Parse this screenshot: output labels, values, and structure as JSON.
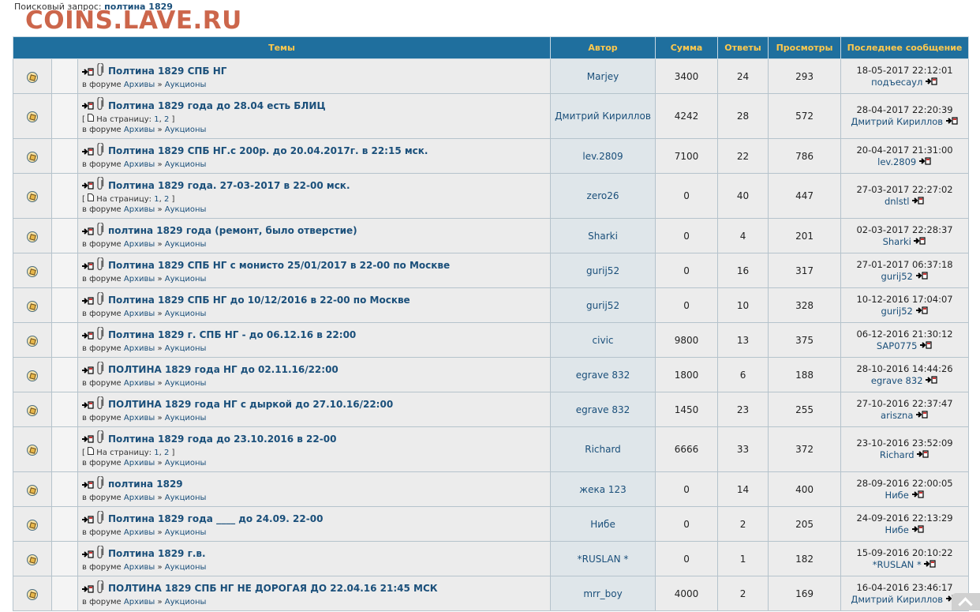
{
  "search": {
    "label": "Поисковый запрос:",
    "query": "полтина 1829"
  },
  "watermark": "COINS.LAVE.RU",
  "headers": {
    "topics": "Темы",
    "author": "Автор",
    "sum": "Сумма",
    "replies": "Ответы",
    "views": "Просмотры",
    "last": "Последнее сообщение"
  },
  "labels": {
    "in_forum": "в форуме",
    "forum_archive": "Архивы",
    "sep": "»",
    "forum_auctions": "Аукционы",
    "pages_open": "[",
    "pages_label": "На страницу:",
    "page1": "1",
    "page2": "2",
    "pages_close": "]"
  },
  "colors": {
    "header_bg": "#1f6f9e",
    "header_text": "#ffc94d",
    "link": "#1a4f7a",
    "watermark": "#c85a3c"
  },
  "rows": [
    {
      "title": "Полтина 1829 СПБ НГ",
      "pages": false,
      "author": "Marjey",
      "sum": "3400",
      "replies": "24",
      "views": "293",
      "last_date": "18-05-2017 22:12:01",
      "last_user": "подъесаул"
    },
    {
      "title": "Полтина 1829 года до 28.04 есть БЛИЦ",
      "pages": true,
      "author": "Дмитрий Кириллов",
      "sum": "4242",
      "replies": "28",
      "views": "572",
      "last_date": "28-04-2017 22:20:39",
      "last_user": "Дмитрий Кириллов"
    },
    {
      "title": "Полтина 1829 СПБ НГ.с 200р. до 20.04.2017г. в 22:15 мск.",
      "pages": false,
      "author": "lev.2809",
      "sum": "7100",
      "replies": "22",
      "views": "786",
      "last_date": "20-04-2017 21:31:00",
      "last_user": "lev.2809"
    },
    {
      "title": "Полтина 1829 года. 27-03-2017 в 22-00 мск.",
      "pages": true,
      "author": "zero26",
      "sum": "0",
      "replies": "40",
      "views": "447",
      "last_date": "27-03-2017 22:27:02",
      "last_user": "dnlstl"
    },
    {
      "title": "полтина 1829 года (ремонт, было отверстие)",
      "pages": false,
      "author": "Sharki",
      "sum": "0",
      "replies": "4",
      "views": "201",
      "last_date": "02-03-2017 22:28:37",
      "last_user": "Sharki"
    },
    {
      "title": "Полтина 1829 СПБ НГ с монисто 25/01/2017 в 22-00 по Москве",
      "pages": false,
      "author": "gurij52",
      "sum": "0",
      "replies": "16",
      "views": "317",
      "last_date": "27-01-2017 06:37:18",
      "last_user": "gurij52"
    },
    {
      "title": "Полтина 1829 СПБ НГ до 10/12/2016 в 22-00 по Москве",
      "pages": false,
      "author": "gurij52",
      "sum": "0",
      "replies": "10",
      "views": "328",
      "last_date": "10-12-2016 17:04:07",
      "last_user": "gurij52"
    },
    {
      "title": "Полтина 1829 г. СПБ НГ - до 06.12.16 в 22:00",
      "pages": false,
      "author": "civic",
      "sum": "9800",
      "replies": "13",
      "views": "375",
      "last_date": "06-12-2016 21:30:12",
      "last_user": "SAP0775"
    },
    {
      "title": "ПОЛТИНА 1829 года НГ до 02.11.16/22:00",
      "pages": false,
      "author": "egrave 832",
      "sum": "1800",
      "replies": "6",
      "views": "188",
      "last_date": "28-10-2016 14:44:26",
      "last_user": "egrave 832"
    },
    {
      "title": "ПОЛТИНА 1829 года НГ с дыркой до 27.10.16/22:00",
      "pages": false,
      "author": "egrave 832",
      "sum": "1450",
      "replies": "23",
      "views": "255",
      "last_date": "27-10-2016 22:37:47",
      "last_user": "ariszna"
    },
    {
      "title": "Полтина 1829 года до 23.10.2016 в 22-00",
      "pages": true,
      "author": "Richard",
      "sum": "6666",
      "replies": "33",
      "views": "372",
      "last_date": "23-10-2016 23:52:09",
      "last_user": "Richard"
    },
    {
      "title": "полтина 1829",
      "pages": false,
      "author": "жека 123",
      "sum": "0",
      "replies": "14",
      "views": "400",
      "last_date": "28-09-2016 22:00:05",
      "last_user": "Нибе"
    },
    {
      "title": "Полтина 1829 года ____ до 24.09. 22-00",
      "pages": false,
      "author": "Нибе",
      "sum": "0",
      "replies": "2",
      "views": "205",
      "last_date": "24-09-2016 22:13:29",
      "last_user": "Нибе"
    },
    {
      "title": "Полтина 1829 г.в.",
      "pages": false,
      "author": "*RUSLAN *",
      "sum": "0",
      "replies": "1",
      "views": "182",
      "last_date": "15-09-2016 20:10:22",
      "last_user": "*RUSLAN *"
    },
    {
      "title": "ПОЛТИНА 1829 СПБ НГ НЕ ДОРОГАЯ ДО 22.04.16 21:45 МСК",
      "pages": false,
      "author": "mrr_boy",
      "sum": "4000",
      "replies": "2",
      "views": "169",
      "last_date": "16-04-2016 23:46:17",
      "last_user": "Дмитрий Кириллов"
    }
  ]
}
